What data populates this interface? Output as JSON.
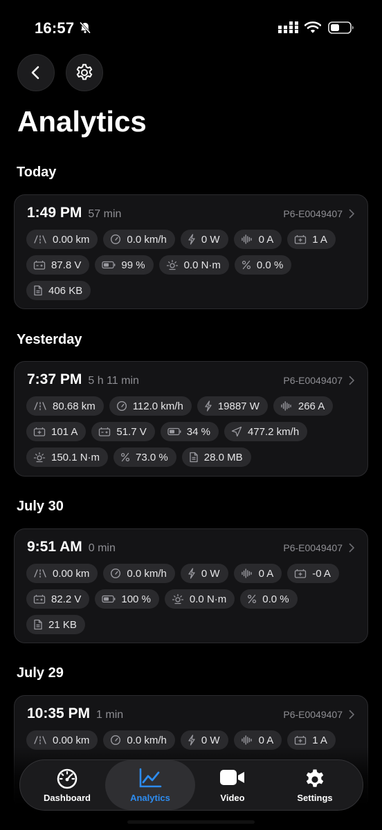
{
  "status": {
    "time": "16:57"
  },
  "header": {
    "title": "Analytics"
  },
  "sessions": [
    {
      "section": "Today",
      "time": "1:49 PM",
      "duration": "57 min",
      "device": "P6-E0049407",
      "metrics": [
        {
          "icon": "distance-icon",
          "value": "0.00 km"
        },
        {
          "icon": "speedometer-icon",
          "value": "0.0 km/h"
        },
        {
          "icon": "power-icon",
          "value": "0 W"
        },
        {
          "icon": "current-wave-icon",
          "value": "0 A"
        },
        {
          "icon": "battery-current-icon",
          "value": "1 A"
        },
        {
          "icon": "battery-voltage-icon",
          "value": "87.8 V"
        },
        {
          "icon": "battery-level-icon",
          "value": "99 %"
        },
        {
          "icon": "torque-icon",
          "value": "0.0 N·m"
        },
        {
          "icon": "percent-icon",
          "value": "0.0 %"
        },
        {
          "icon": "file-icon",
          "value": "406 KB"
        }
      ]
    },
    {
      "section": "Yesterday",
      "time": "7:37 PM",
      "duration": "5 h 11 min",
      "device": "P6-E0049407",
      "metrics": [
        {
          "icon": "distance-icon",
          "value": "80.68 km"
        },
        {
          "icon": "speedometer-icon",
          "value": "112.0 km/h"
        },
        {
          "icon": "power-icon",
          "value": "19887 W"
        },
        {
          "icon": "current-wave-icon",
          "value": "266 A"
        },
        {
          "icon": "battery-current-icon",
          "value": "101 A"
        },
        {
          "icon": "battery-voltage-icon",
          "value": "51.7 V"
        },
        {
          "icon": "battery-level-icon",
          "value": "34 %"
        },
        {
          "icon": "gps-speed-icon",
          "value": "477.2 km/h"
        },
        {
          "icon": "torque-icon",
          "value": "150.1 N·m"
        },
        {
          "icon": "percent-icon",
          "value": "73.0 %"
        },
        {
          "icon": "file-icon",
          "value": "28.0 MB"
        }
      ]
    },
    {
      "section": "July 30",
      "time": "9:51 AM",
      "duration": "0 min",
      "device": "P6-E0049407",
      "metrics": [
        {
          "icon": "distance-icon",
          "value": "0.00 km"
        },
        {
          "icon": "speedometer-icon",
          "value": "0.0 km/h"
        },
        {
          "icon": "power-icon",
          "value": "0 W"
        },
        {
          "icon": "current-wave-icon",
          "value": "0 A"
        },
        {
          "icon": "battery-current-icon",
          "value": "-0 A"
        },
        {
          "icon": "battery-voltage-icon",
          "value": "82.2 V"
        },
        {
          "icon": "battery-level-icon",
          "value": "100 %"
        },
        {
          "icon": "torque-icon",
          "value": "0.0 N·m"
        },
        {
          "icon": "percent-icon",
          "value": "0.0 %"
        },
        {
          "icon": "file-icon",
          "value": "21 KB"
        }
      ]
    },
    {
      "section": "July 29",
      "time": "10:35 PM",
      "duration": "1 min",
      "device": "P6-E0049407",
      "metrics": [
        {
          "icon": "distance-icon",
          "value": "0.00 km"
        },
        {
          "icon": "speedometer-icon",
          "value": "0.0 km/h"
        },
        {
          "icon": "power-icon",
          "value": "0 W"
        },
        {
          "icon": "current-wave-icon",
          "value": "0 A"
        },
        {
          "icon": "battery-current-icon",
          "value": "1 A"
        }
      ]
    }
  ],
  "tabbar": {
    "tabs": [
      {
        "label": "Dashboard",
        "icon": "speedometer-icon"
      },
      {
        "label": "Analytics",
        "icon": "chart-line-icon",
        "active": true
      },
      {
        "label": "Video",
        "icon": "video-camera-icon"
      },
      {
        "label": "Settings",
        "icon": "gear-icon"
      }
    ]
  },
  "colors": {
    "accent": "#2d8cf0",
    "background": "#000000",
    "card": "#141416",
    "chip": "#2a2a2d"
  }
}
